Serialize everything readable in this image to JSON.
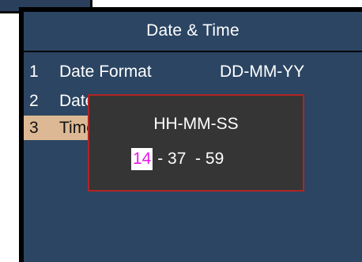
{
  "screen": {
    "title": "Date & Time"
  },
  "menu": {
    "items": [
      {
        "num": "1",
        "label": "Date Format",
        "value": "DD-MM-YY"
      },
      {
        "num": "2",
        "label": "Date Setup",
        "value": ""
      },
      {
        "num": "3",
        "label": "Time Setup",
        "value": ""
      }
    ],
    "selected_index": 2
  },
  "time_dialog": {
    "title": "HH-MM-SS",
    "hour": "14",
    "separator_1": " - ",
    "minute": "37",
    "separator_2": "  - ",
    "second": "59"
  },
  "colors": {
    "screen_bg": "#2b4563",
    "selected_row_bg": "#dcb994",
    "dialog_bg": "#353535",
    "dialog_border": "#b12424",
    "hour_highlight_text": "#e619e6"
  }
}
